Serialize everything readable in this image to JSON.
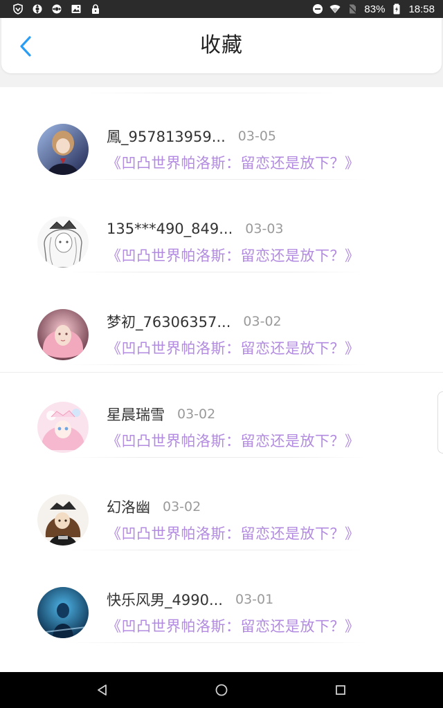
{
  "status_bar": {
    "left_icons": [
      "shield-icon",
      "sync-icon",
      "sync-icon",
      "image-icon",
      "lock-icon"
    ],
    "right_icons": [
      "dnd-icon",
      "wifi-icon",
      "no-sim-icon",
      "battery-icon"
    ],
    "battery": "83%",
    "time": "18:58"
  },
  "header": {
    "title": "收藏",
    "back_icon": "chevron-left-icon",
    "accent_color": "#2a9df4"
  },
  "favorites": [
    {
      "name": "鳳_957813959...",
      "date": "03-05",
      "work": "《凹凸世界帕洛斯：留恋还是放下？》"
    },
    {
      "name": "135***490_849...",
      "date": "03-03",
      "work": "《凹凸世界帕洛斯：留恋还是放下？》"
    },
    {
      "name": "梦初_76306357...",
      "date": "03-02",
      "work": "《凹凸世界帕洛斯：留恋还是放下？》"
    },
    {
      "name": "星晨瑞雪",
      "date": "03-02",
      "work": "《凹凸世界帕洛斯：留恋还是放下？》"
    },
    {
      "name": "幻洛幽",
      "date": "03-02",
      "work": "《凹凸世界帕洛斯：留恋还是放下？》"
    },
    {
      "name": "快乐风男_4990...",
      "date": "03-01",
      "work": "《凹凸世界帕洛斯：留恋还是放下？》"
    }
  ],
  "colors": {
    "work_title": "#b28be0",
    "name": "#333333",
    "date": "#9a9a9a"
  },
  "nav_bar": {
    "buttons": [
      "back-triangle-icon",
      "home-circle-icon",
      "recents-square-icon"
    ]
  }
}
